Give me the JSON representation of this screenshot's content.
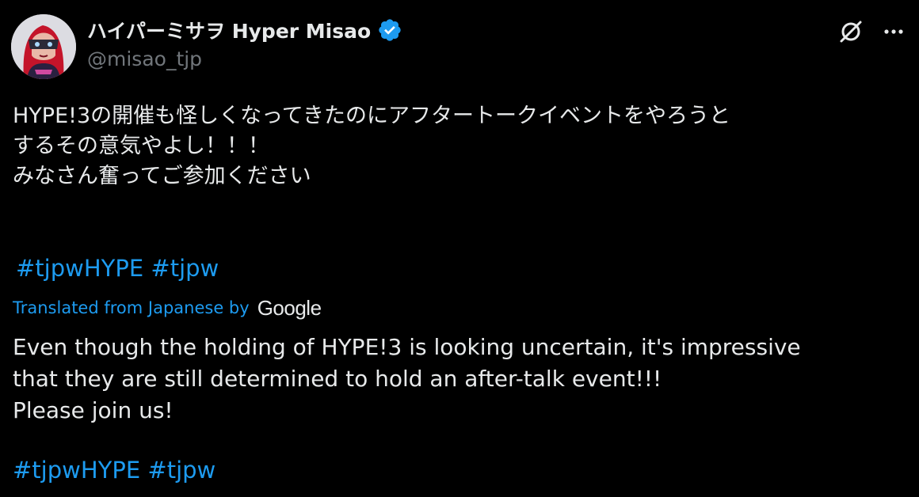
{
  "author": {
    "display_name": "ハイパーミサヲ Hyper Misao",
    "handle": "@misao_tjp"
  },
  "icons": {
    "avatar": "avatar-image",
    "verified": "verified-badge-icon",
    "grok": "grok-icon",
    "more": "more-options-icon"
  },
  "colors": {
    "background": "#000000",
    "text": "#e7e9ea",
    "muted": "#71767b",
    "accent": "#1d9bf0"
  },
  "tweet": {
    "original_lines": [
      "HYPE!3の開催も怪しくなってきたのにアフタートークイベントをやろうと",
      "するその意気やよし！！！",
      "みなさん奮ってご参加ください"
    ],
    "original_hashtags": [
      "#tjpwHYPE",
      "#tjpw"
    ],
    "translation_label": "Translated from Japanese by",
    "translation_provider": "Google",
    "translated_lines": [
      "Even though the holding of HYPE!3 is looking uncertain, it's impressive",
      "that they are still determined to hold an after-talk event!!!",
      "Please join us!"
    ],
    "translated_hashtags": [
      "#tjpwHYPE",
      "#tjpw"
    ]
  }
}
